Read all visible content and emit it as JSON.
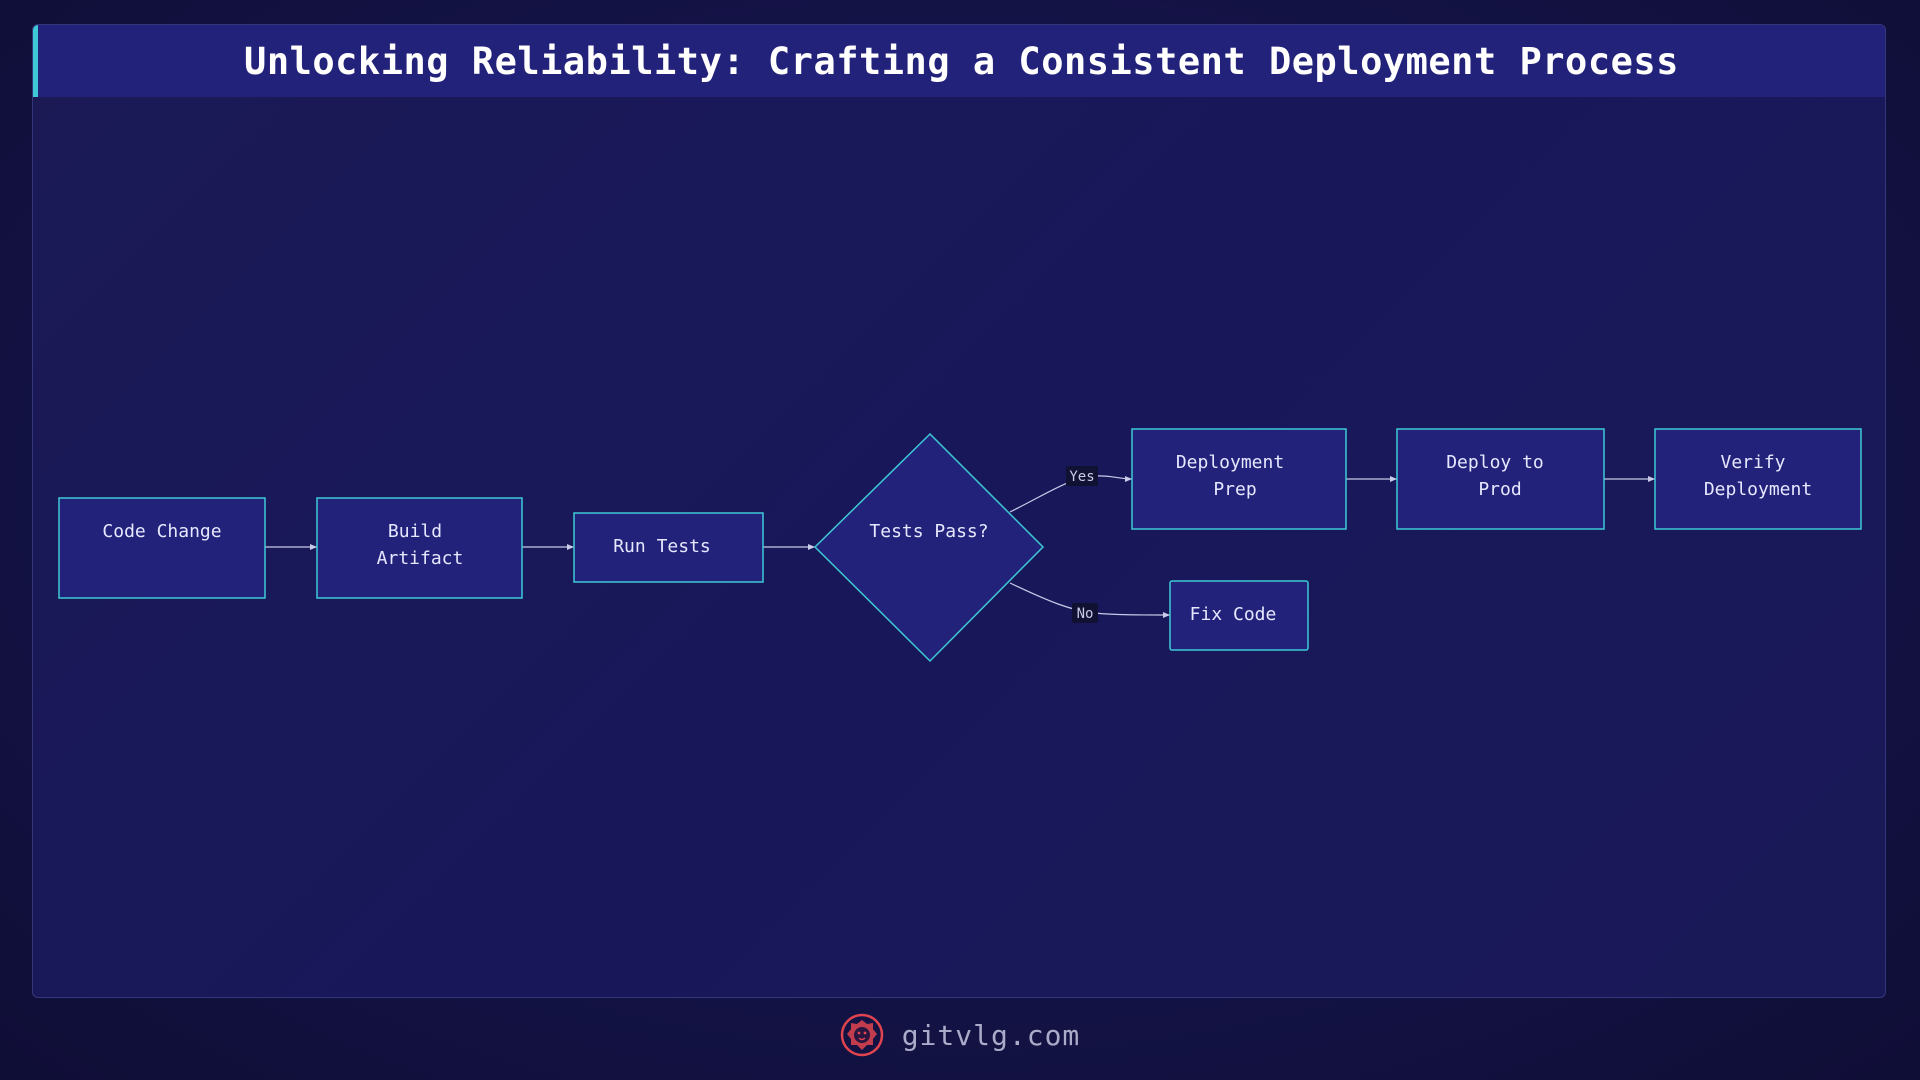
{
  "title": "Unlocking Reliability: Crafting a Consistent Deployment Process",
  "colors": {
    "node_fill": "#23227a",
    "node_stroke": "#3ec9d6",
    "edge": "#c9cbe8",
    "accent": "#3ec9d6",
    "logo": "#e0444e"
  },
  "nodes": {
    "code_change": "Code Change",
    "build_artifact": [
      "Build",
      "Artifact"
    ],
    "run_tests": "Run Tests",
    "tests_pass": "Tests Pass?",
    "deployment_prep": [
      "Deployment",
      "Prep"
    ],
    "deploy_to_prod": [
      "Deploy to",
      "Prod"
    ],
    "verify_deployment": [
      "Verify",
      "Deployment"
    ],
    "fix_code": "Fix Code"
  },
  "edges": {
    "yes_label": "Yes",
    "no_label": "No"
  },
  "footer": {
    "logo_icon": "lion-head-icon",
    "site": "gitvlg.com"
  }
}
